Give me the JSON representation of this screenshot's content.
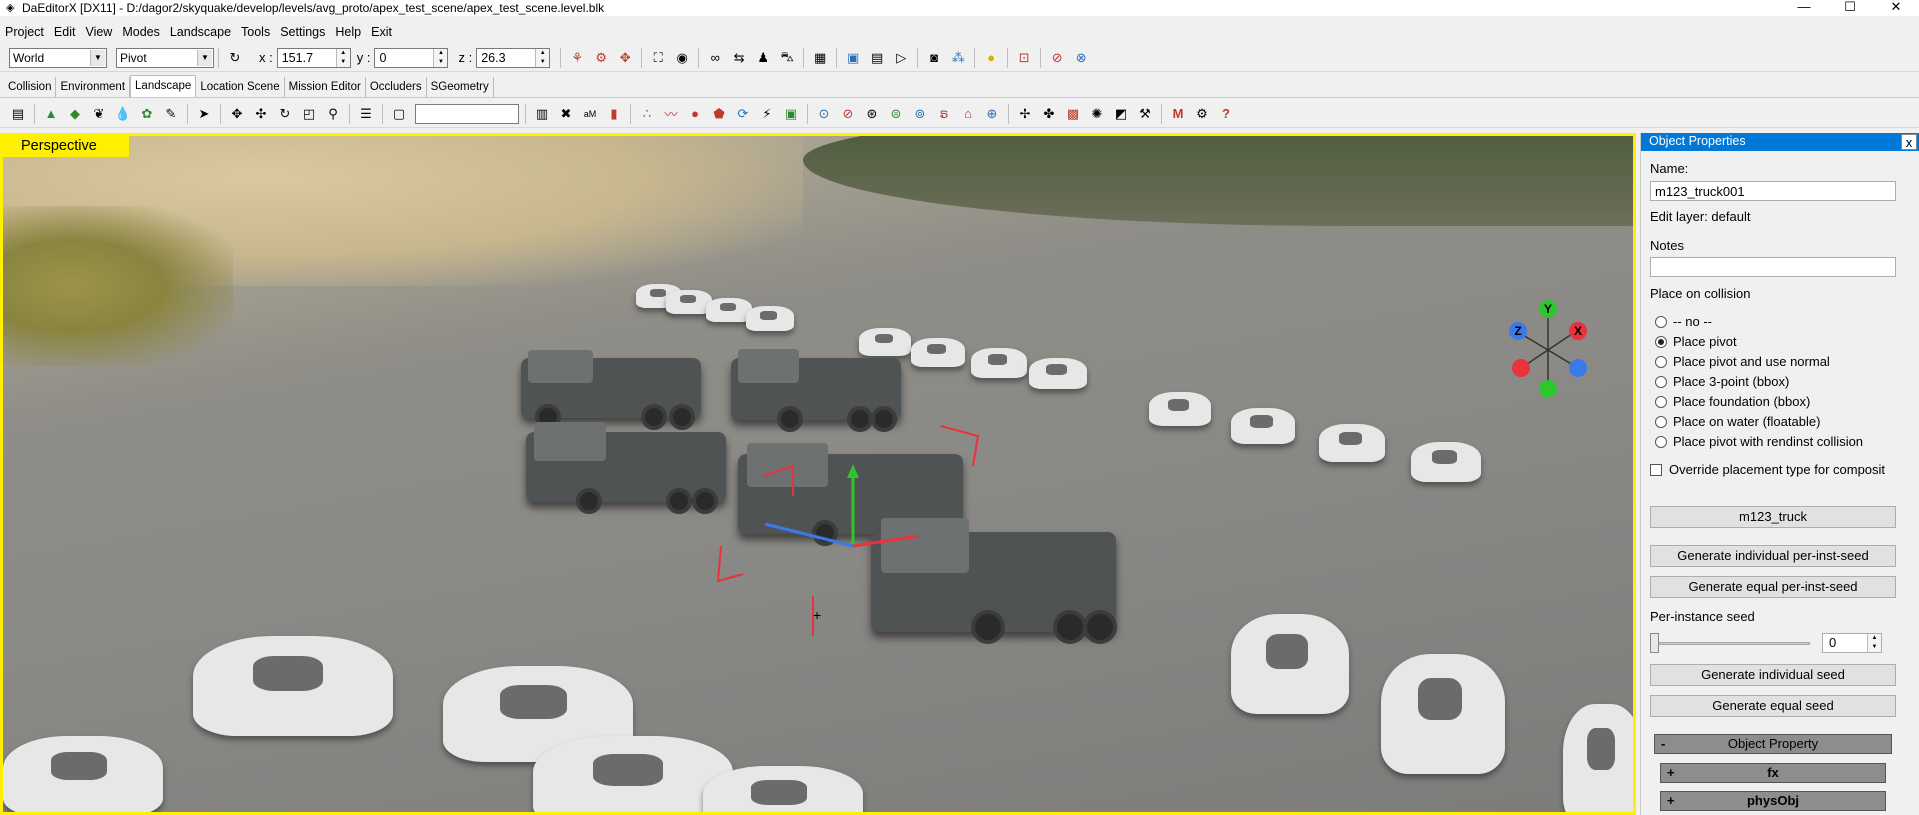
{
  "window": {
    "title": "DaEditorX  [DX11] - D:/dagor2/skyquake/develop/levels/avg_proto/apex_test_scene/apex_test_scene.level.blk",
    "minimize": "—",
    "maximize": "☐",
    "close": "✕"
  },
  "menu": [
    "Project",
    "Edit",
    "View",
    "Modes",
    "Landscape",
    "Tools",
    "Settings",
    "Help",
    "Exit"
  ],
  "toolbar": {
    "coord_system": "World",
    "pivot_mode": "Pivot",
    "x_label": "x :",
    "x_value": "151.7",
    "y_label": "y :",
    "y_value": "0",
    "z_label": "z :",
    "z_value": "26.3"
  },
  "tabs": [
    "Collision",
    "Environment",
    "Landscape",
    "Location Scene",
    "Mission Editor",
    "Occluders",
    "SGeometry"
  ],
  "active_tab": "Landscape",
  "search": {
    "value": ""
  },
  "viewport": {
    "label": "Perspective",
    "gizmo": {
      "y": "Y",
      "x": "X",
      "z": "Z"
    }
  },
  "panel": {
    "title": "Object Properties",
    "close": "x",
    "name_label": "Name:",
    "name_value": "m123_truck001",
    "edit_layer": "Edit layer:  default",
    "notes_label": "Notes",
    "notes_value": "",
    "place_label": "Place on collision",
    "place_options": [
      "-- no --",
      "Place pivot",
      "Place pivot and use normal",
      "Place 3-point (bbox)",
      "Place foundation (bbox)",
      "Place on water (floatable)",
      "Place pivot with rendinst collision"
    ],
    "place_selected": "Place pivot",
    "override_label": "Override placement type for composit",
    "asset_button": "m123_truck",
    "gen_indiv_per_inst": "Generate individual per-inst-seed",
    "gen_equal_per_inst": "Generate equal per-inst-seed",
    "per_instance_label": "Per-instance seed",
    "per_instance_value": "0",
    "gen_indiv_seed": "Generate individual seed",
    "gen_equal_seed": "Generate equal seed",
    "group_object_property": {
      "toggle": "-",
      "label": "Object Property"
    },
    "group_fx": {
      "toggle": "+",
      "label": "fx"
    },
    "group_physobj": {
      "toggle": "+",
      "label": "physObj"
    }
  },
  "colors": {
    "viewport_border": "#ffef00",
    "panel_header": "#0078d7",
    "gizmo_x": "#e8333a",
    "gizmo_y": "#2ec52e",
    "gizmo_z": "#3a7ae8"
  }
}
